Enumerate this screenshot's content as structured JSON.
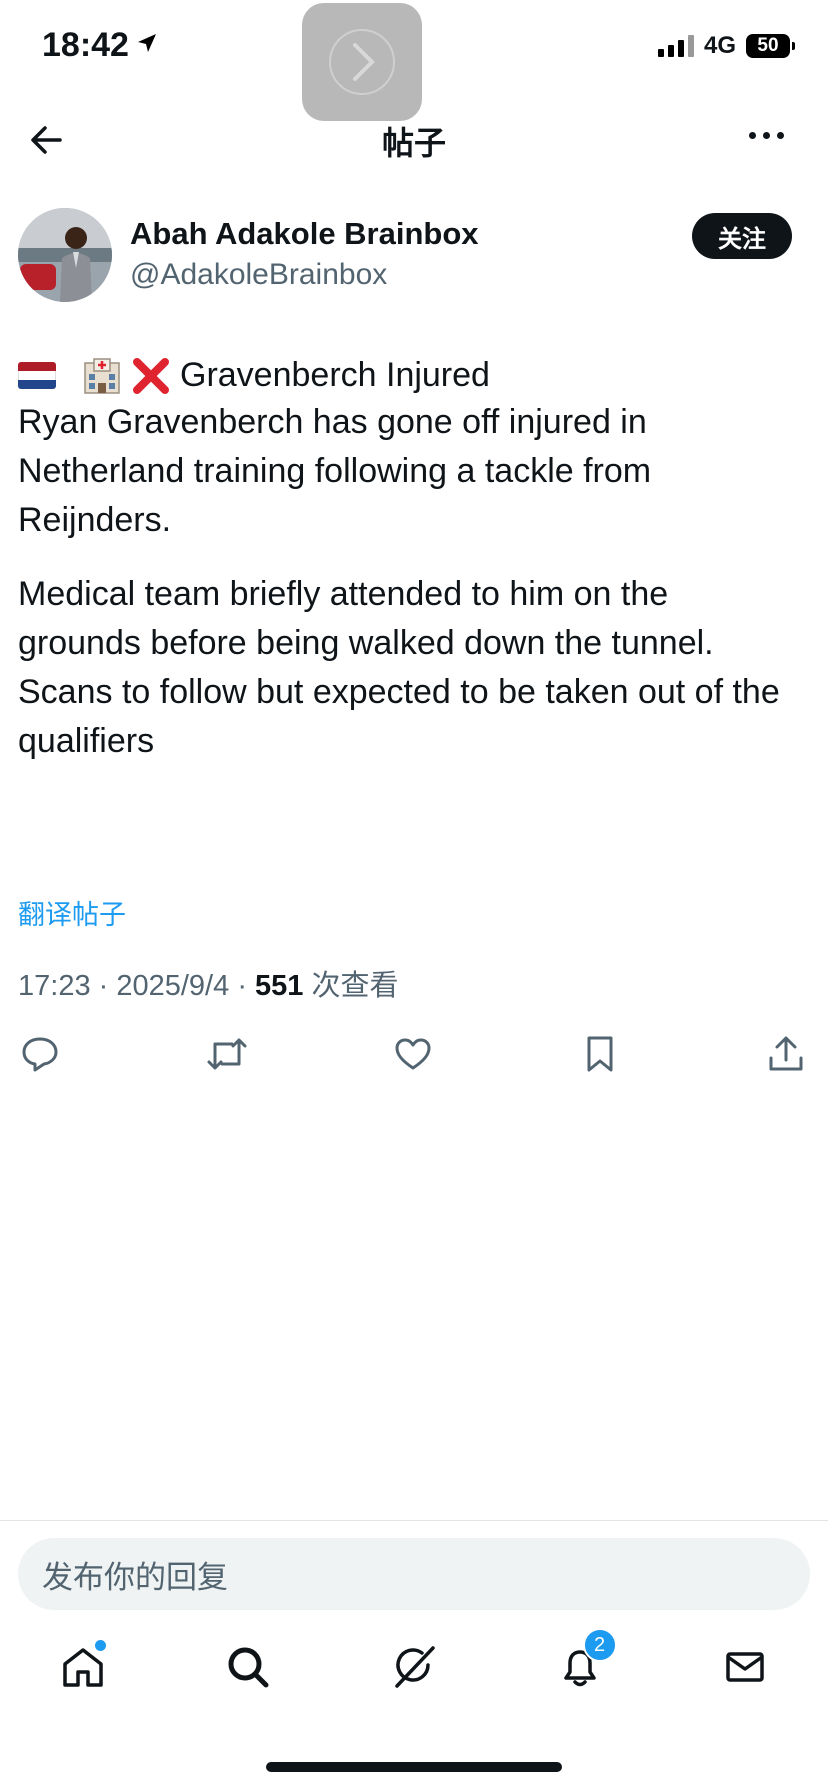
{
  "status_bar": {
    "time": "18:42",
    "network": "4G",
    "battery": "50"
  },
  "header": {
    "title": "帖子"
  },
  "author": {
    "name": "Abah Adakole Brainbox",
    "handle": "@AdakoleBrainbox",
    "follow_label": "关注"
  },
  "post": {
    "headline": "Gravenberch Injured",
    "paragraph1": " Ryan Gravenberch has gone off injured in Netherland training following a tackle from Reijnders.",
    "paragraph2": "Medical team briefly attended to him on the grounds before being walked down the tunnel. Scans to follow but expected to be taken out of the  qualifiers",
    "translate_label": "翻译帖子",
    "time": "17:23",
    "date": "2025/9/4",
    "views": "551",
    "views_label": "次查看"
  },
  "reply": {
    "placeholder": "发布你的回复"
  },
  "tabbar": {
    "notifications_badge": "2"
  },
  "colors": {
    "accent": "#1d9bf0",
    "text": "#0f1419",
    "secondary": "#536471"
  }
}
